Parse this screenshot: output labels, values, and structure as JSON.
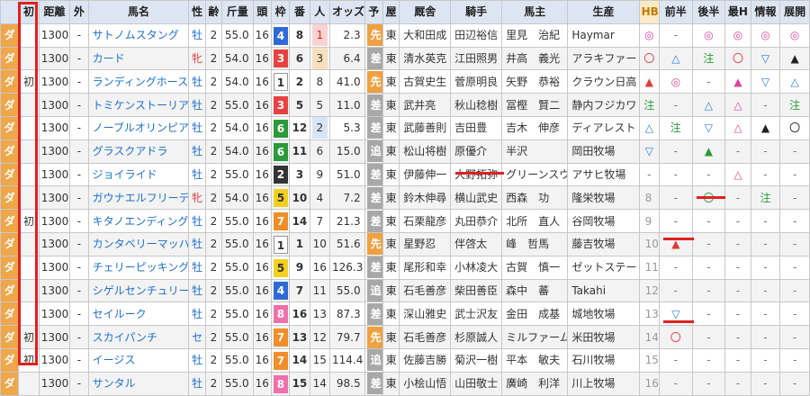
{
  "headers": {
    "type": "",
    "first": "初",
    "dist": "距離",
    "outer": "外",
    "name": "馬名",
    "sex": "性",
    "age": "齢",
    "weight": "斤量",
    "heads": "頭",
    "waku": "枠",
    "num": "番",
    "pop": "人",
    "odds": "オッズ",
    "yoso": "予",
    "course": "屋",
    "stable": "厩舎",
    "jockey": "騎手",
    "owner": "馬主",
    "breeder": "生産",
    "hb": "HB",
    "zenhan": "前半",
    "kouhan": "後半",
    "saiko": "最H",
    "info": "情報",
    "tenkai": "展開"
  },
  "rows": [
    {
      "type": "ダ",
      "first": "",
      "dist": "1300",
      "outer": "-",
      "name": "サトノムスタング",
      "sex": "牡",
      "age": "2",
      "weight": "55.0",
      "heads": "16",
      "waku": "4",
      "num": "8",
      "pop": "1",
      "odds": "2.3",
      "yoso": "先",
      "course": "東",
      "stable": "大和田成",
      "jockey": "田辺裕信",
      "owner": "里見　治紀",
      "breeder": "Haymar",
      "hb": "◎",
      "zenhan": "-",
      "kouhan": "◎",
      "saiko": "◎",
      "info": "◎",
      "tenkai": "◎"
    },
    {
      "type": "ダ",
      "first": "",
      "dist": "1300",
      "outer": "-",
      "name": "カード",
      "sex": "牝",
      "age": "2",
      "weight": "54.0",
      "heads": "16",
      "waku": "3",
      "num": "6",
      "pop": "3",
      "odds": "6.4",
      "yoso": "差",
      "course": "東",
      "stable": "清水英克",
      "jockey": "江田照男",
      "owner": "井高　義光",
      "breeder": "アラキファー",
      "hb": "〇",
      "zenhan": "△",
      "kouhan": "注",
      "saiko": "〇",
      "info": "▽",
      "tenkai": "▲"
    },
    {
      "type": "ダ",
      "first": "初",
      "dist": "1300",
      "outer": "-",
      "name": "ランディングホース",
      "sex": "牡",
      "age": "2",
      "weight": "54.0",
      "heads": "16",
      "waku": "1",
      "num": "2",
      "pop": "8",
      "odds": "41.0",
      "yoso": "先",
      "course": "東",
      "stable": "古賀史生",
      "jockey": "菅原明良",
      "owner": "矢野　恭裕",
      "breeder": "クラウン日高",
      "hb": "▲",
      "zenhan": "◎",
      "kouhan": "-",
      "saiko": "▲",
      "info": "▽",
      "tenkai": "△"
    },
    {
      "type": "ダ",
      "first": "",
      "dist": "1300",
      "outer": "-",
      "name": "トミケンストーリア",
      "sex": "牡",
      "age": "2",
      "weight": "55.0",
      "heads": "16",
      "waku": "3",
      "num": "5",
      "pop": "5",
      "odds": "11.0",
      "yoso": "差",
      "course": "東",
      "stable": "武井亮",
      "jockey": "秋山稔樹",
      "owner": "冨樫　賢二",
      "breeder": "静内フジカワ",
      "hb": "注",
      "zenhan": "-",
      "kouhan": "△",
      "saiko": "△",
      "info": "-",
      "tenkai": "注"
    },
    {
      "type": "ダ",
      "first": "",
      "dist": "1300",
      "outer": "-",
      "name": "ノーブルオリンピア",
      "sex": "牡",
      "age": "2",
      "weight": "54.0",
      "heads": "16",
      "waku": "6",
      "num": "12",
      "pop": "2",
      "odds": "5.3",
      "yoso": "差",
      "course": "東",
      "stable": "武藤善則",
      "jockey": "吉田豊",
      "owner": "吉木　伸彦",
      "breeder": "ディアレスト",
      "hb": "△",
      "zenhan": "注",
      "kouhan": "▽",
      "saiko": "△",
      "info": "▲",
      "tenkai": "〇"
    },
    {
      "type": "ダ",
      "first": "",
      "dist": "1300",
      "outer": "-",
      "name": "グラスクアドラ",
      "sex": "牡",
      "age": "2",
      "weight": "54.0",
      "heads": "16",
      "waku": "6",
      "num": "11",
      "pop": "6",
      "odds": "15.0",
      "yoso": "追",
      "course": "東",
      "stable": "松山将樹",
      "jockey": "原優介",
      "owner": "半沢",
      "breeder": "岡田牧場",
      "hb": "▽",
      "zenhan": "-",
      "kouhan": "▲",
      "saiko": "-",
      "info": "-",
      "tenkai": "-"
    },
    {
      "type": "ダ",
      "first": "",
      "dist": "1300",
      "outer": "-",
      "name": "ジョイライド",
      "sex": "牡",
      "age": "2",
      "weight": "55.0",
      "heads": "16",
      "waku": "2",
      "num": "3",
      "pop": "9",
      "odds": "51.0",
      "yoso": "差",
      "course": "東",
      "stable": "伊藤伸一",
      "jockey": "大野拓弥",
      "owner": "グリーンスウ",
      "breeder": "アサヒ牧場",
      "hb": "-",
      "zenhan": "-",
      "kouhan": "-",
      "saiko": "△",
      "info": "-",
      "tenkai": "-"
    },
    {
      "type": "ダ",
      "first": "",
      "dist": "1300",
      "outer": "-",
      "name": "ガウナエルフリーデ",
      "sex": "牝",
      "age": "2",
      "weight": "54.0",
      "heads": "16",
      "waku": "5",
      "num": "10",
      "pop": "4",
      "odds": "7.2",
      "yoso": "差",
      "course": "東",
      "stable": "鈴木伸尋",
      "jockey": "横山武史",
      "owner": "西森　功",
      "breeder": "隆栄牧場",
      "hb": "8",
      "zenhan": "-",
      "kouhan": "〇",
      "saiko": "-",
      "info": "注",
      "tenkai": "-"
    },
    {
      "type": "ダ",
      "first": "初",
      "dist": "1300",
      "outer": "-",
      "name": "キタノエンディング",
      "sex": "牡",
      "age": "2",
      "weight": "55.0",
      "heads": "16",
      "waku": "7",
      "num": "14",
      "pop": "7",
      "odds": "21.3",
      "yoso": "差",
      "course": "東",
      "stable": "石栗龍彦",
      "jockey": "丸田恭介",
      "owner": "北所　直人",
      "breeder": "谷岡牧場",
      "hb": "9",
      "zenhan": "-",
      "kouhan": "-",
      "saiko": "-",
      "info": "-",
      "tenkai": "-"
    },
    {
      "type": "ダ",
      "first": "",
      "dist": "1300",
      "outer": "-",
      "name": "カンタベリーマッハ",
      "sex": "牡",
      "age": "2",
      "weight": "55.0",
      "heads": "16",
      "waku": "1",
      "num": "1",
      "pop": "10",
      "odds": "51.6",
      "yoso": "先",
      "course": "東",
      "stable": "星野忍",
      "jockey": "伴啓太",
      "owner": "峰　哲馬",
      "breeder": "藤吉牧場",
      "hb": "10",
      "zenhan": "▲",
      "kouhan": "-",
      "saiko": "-",
      "info": "-",
      "tenkai": "-"
    },
    {
      "type": "ダ",
      "first": "",
      "dist": "1300",
      "outer": "-",
      "name": "チェリーピッキング",
      "sex": "牡",
      "age": "2",
      "weight": "55.0",
      "heads": "16",
      "waku": "5",
      "num": "9",
      "pop": "16",
      "odds": "126.3",
      "yoso": "差",
      "course": "東",
      "stable": "尾形和幸",
      "jockey": "小林凌大",
      "owner": "古賀　慎一",
      "breeder": "ゼットステー",
      "hb": "11",
      "zenhan": "-",
      "kouhan": "-",
      "saiko": "-",
      "info": "-",
      "tenkai": "-"
    },
    {
      "type": "ダ",
      "first": "",
      "dist": "1300",
      "outer": "-",
      "name": "シゲルセンチュリー",
      "sex": "牡",
      "age": "2",
      "weight": "55.0",
      "heads": "16",
      "waku": "4",
      "num": "7",
      "pop": "11",
      "odds": "55.0",
      "yoso": "追",
      "course": "東",
      "stable": "石毛善彦",
      "jockey": "柴田善臣",
      "owner": "森中　蕃",
      "breeder": "Takahi",
      "hb": "12",
      "zenhan": "-",
      "kouhan": "-",
      "saiko": "-",
      "info": "-",
      "tenkai": "-"
    },
    {
      "type": "ダ",
      "first": "",
      "dist": "1300",
      "outer": "-",
      "name": "セイルーク",
      "sex": "牡",
      "age": "2",
      "weight": "55.0",
      "heads": "16",
      "waku": "8",
      "num": "16",
      "pop": "13",
      "odds": "87.3",
      "yoso": "差",
      "course": "東",
      "stable": "深山雅史",
      "jockey": "武士沢友",
      "owner": "金田　成基",
      "breeder": "城地牧場",
      "hb": "13",
      "zenhan": "▽",
      "kouhan": "-",
      "saiko": "-",
      "info": "-",
      "tenkai": "-"
    },
    {
      "type": "ダ",
      "first": "初",
      "dist": "1300",
      "outer": "-",
      "name": "スカイパンチ",
      "sex": "セ",
      "age": "2",
      "weight": "55.0",
      "heads": "16",
      "waku": "7",
      "num": "13",
      "pop": "12",
      "odds": "79.7",
      "yoso": "先",
      "course": "東",
      "stable": "石毛善彦",
      "jockey": "杉原誠人",
      "owner": "ミルファーム",
      "breeder": "米田牧場",
      "hb": "14",
      "zenhan": "〇",
      "kouhan": "-",
      "saiko": "-",
      "info": "-",
      "tenkai": "-"
    },
    {
      "type": "ダ",
      "first": "初",
      "dist": "1300",
      "outer": "-",
      "name": "イージス",
      "sex": "牡",
      "age": "2",
      "weight": "55.0",
      "heads": "16",
      "waku": "7",
      "num": "14",
      "pop": "15",
      "odds": "114.4",
      "yoso": "追",
      "course": "東",
      "stable": "佐藤吉勝",
      "jockey": "菊沢一樹",
      "owner": "平本　敏夫",
      "breeder": "石川牧場",
      "hb": "15",
      "zenhan": "-",
      "kouhan": "-",
      "saiko": "-",
      "info": "-",
      "tenkai": "-"
    },
    {
      "type": "ダ",
      "first": "",
      "dist": "1300",
      "outer": "-",
      "name": "サンタル",
      "sex": "牡",
      "age": "2",
      "weight": "55.0",
      "heads": "16",
      "waku": "8",
      "num": "15",
      "pop": "14",
      "odds": "98.5",
      "yoso": "差",
      "course": "東",
      "stable": "小桧山悟",
      "jockey": "山田敬士",
      "owner": "廣崎　利洋",
      "breeder": "川上牧場",
      "hb": "16",
      "zenhan": "-",
      "kouhan": "-",
      "saiko": "-",
      "info": "-",
      "tenkai": "-"
    }
  ],
  "colors": {
    "header_bg": "#dce6f2",
    "hb_header": "#fde9c4",
    "type_cell": "#f0a64a",
    "name_link": "#1d6fd1",
    "highlight": "#e02020"
  }
}
